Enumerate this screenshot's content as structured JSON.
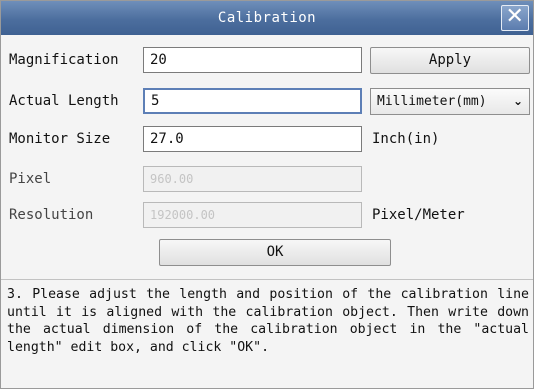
{
  "dialog": {
    "title": "Calibration",
    "close_glyph": "✕"
  },
  "magnification": {
    "label": "Magnification",
    "value": "20"
  },
  "apply_button": {
    "label": "Apply"
  },
  "actual_length": {
    "label": "Actual Length",
    "value": "5"
  },
  "unit_select": {
    "selected": "Millimeter(mm)"
  },
  "monitor_size": {
    "label": "Monitor Size",
    "value": "27.0",
    "unit": "Inch(in)"
  },
  "pixel": {
    "label": "Pixel",
    "value": "960.00"
  },
  "resolution": {
    "label": "Resolution",
    "value": "192000.00",
    "unit": "Pixel/Meter"
  },
  "ok_button": {
    "label": "OK"
  },
  "instructions": {
    "text": "3. Please adjust the length and position of the calibration line until it is aligned with the calibration object. Then write down the actual dimension of the calibration object in the \"actual length\" edit box, and click \"OK\"."
  },
  "colors": {
    "titlebar": "#4c6e9e",
    "dialog_bg": "#f4f4f4",
    "focus_border": "#5d7fb6"
  }
}
